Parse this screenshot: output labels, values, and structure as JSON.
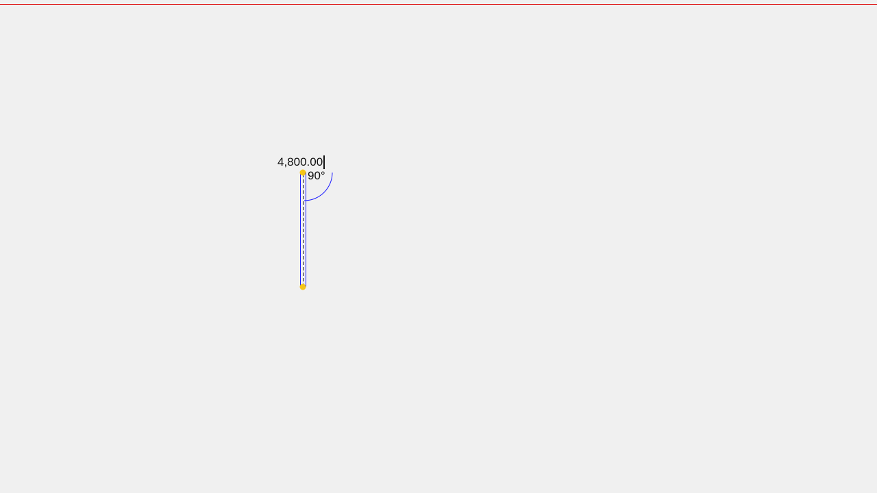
{
  "dimension": {
    "length_value": "4,800.00",
    "angle_value": "90°"
  },
  "colors": {
    "background": "#f0f0f0",
    "guide_line": "#e02020",
    "wall_outline": "#1a1aff",
    "centerline": "#222222",
    "angle_arc": "#1a1aff",
    "endpoint": "#f5c518"
  },
  "icons": {
    "start_point": "endpoint-handle",
    "end_point": "endpoint-handle"
  }
}
